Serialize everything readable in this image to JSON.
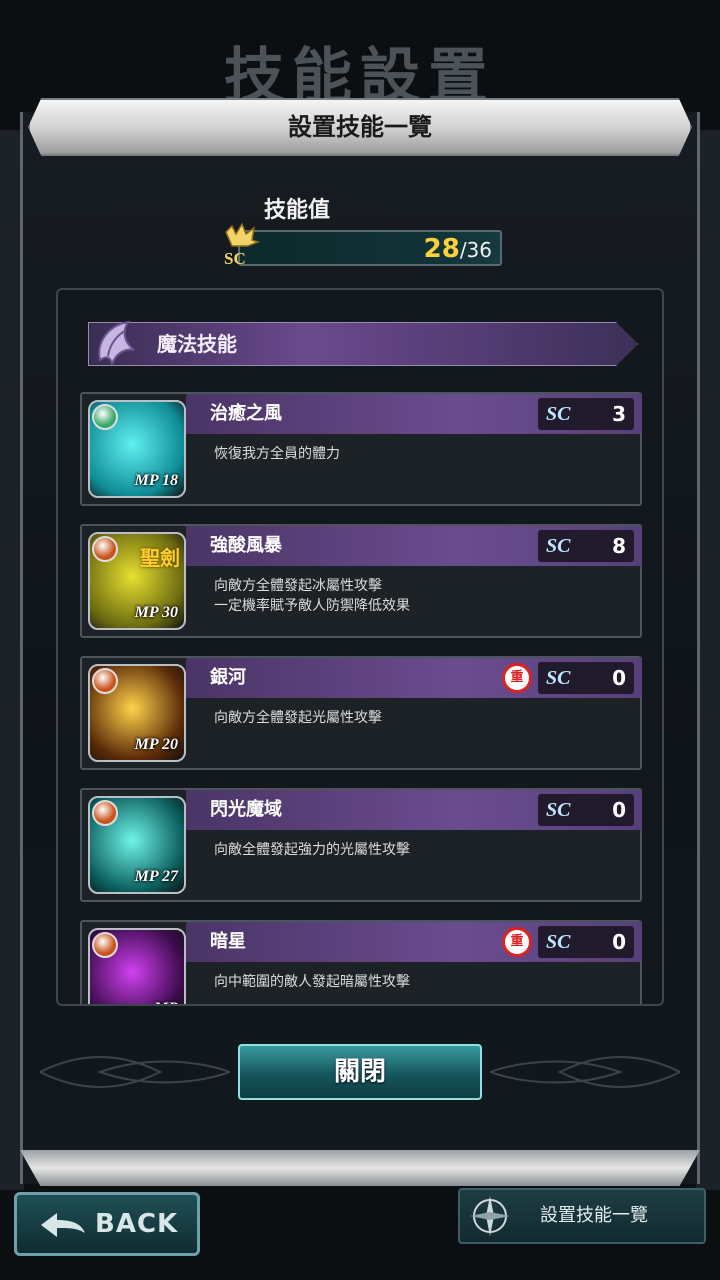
{
  "background": {
    "screen_title": "技能設置"
  },
  "modal": {
    "title": "設置技能一覽",
    "skill_points": {
      "label": "技能值",
      "current": "28",
      "max": "/36",
      "icon": "hand-sc-icon"
    },
    "category": {
      "label": "魔法技能",
      "icon": "magic-wing-icon"
    },
    "skills": [
      {
        "name": "治癒之風",
        "desc": "恢復我方全員的體力",
        "sc_tag": "SC",
        "sc": "3",
        "mp_tag": "MP",
        "mp": "18",
        "badge": "",
        "thumb_colors": [
          "#0f8c96",
          "#5ff0f0"
        ],
        "orb_color": "#3aa86a"
      },
      {
        "name": "強酸風暴",
        "desc": "向敵方全體發起冰屬性攻擊\n一定機率賦予敵人防禦降低效果",
        "sc_tag": "SC",
        "sc": "8",
        "mp_tag": "MP",
        "mp": "30",
        "badge": "",
        "kanji": "聖劍",
        "thumb_colors": [
          "#6b6a10",
          "#e8e030"
        ],
        "orb_color": "#c9541e"
      },
      {
        "name": "銀河",
        "desc": "向敵方全體發起光屬性攻擊",
        "sc_tag": "SC",
        "sc": "0",
        "mp_tag": "MP",
        "mp": "20",
        "badge": "重",
        "thumb_colors": [
          "#5a2a08",
          "#ffd24a"
        ],
        "orb_color": "#c9541e"
      },
      {
        "name": "閃光魔域",
        "desc": "向敵全體發起強力的光屬性攻擊",
        "sc_tag": "SC",
        "sc": "0",
        "mp_tag": "MP",
        "mp": "27",
        "badge": "",
        "thumb_colors": [
          "#0b5c5c",
          "#6ff5e8"
        ],
        "orb_color": "#c9541e"
      },
      {
        "name": "暗星",
        "desc": "向中範圍的敵人發起暗屬性攻擊",
        "sc_tag": "SC",
        "sc": "0",
        "mp_tag": "MP",
        "mp": "",
        "badge": "重",
        "thumb_colors": [
          "#3a0b4a",
          "#d040f0"
        ],
        "orb_color": "#c9541e"
      }
    ],
    "close_label": "關閉"
  },
  "footer": {
    "back_label": "BACK",
    "tab_label": "設置技能一覽",
    "tab_icon": "compass-icon"
  }
}
